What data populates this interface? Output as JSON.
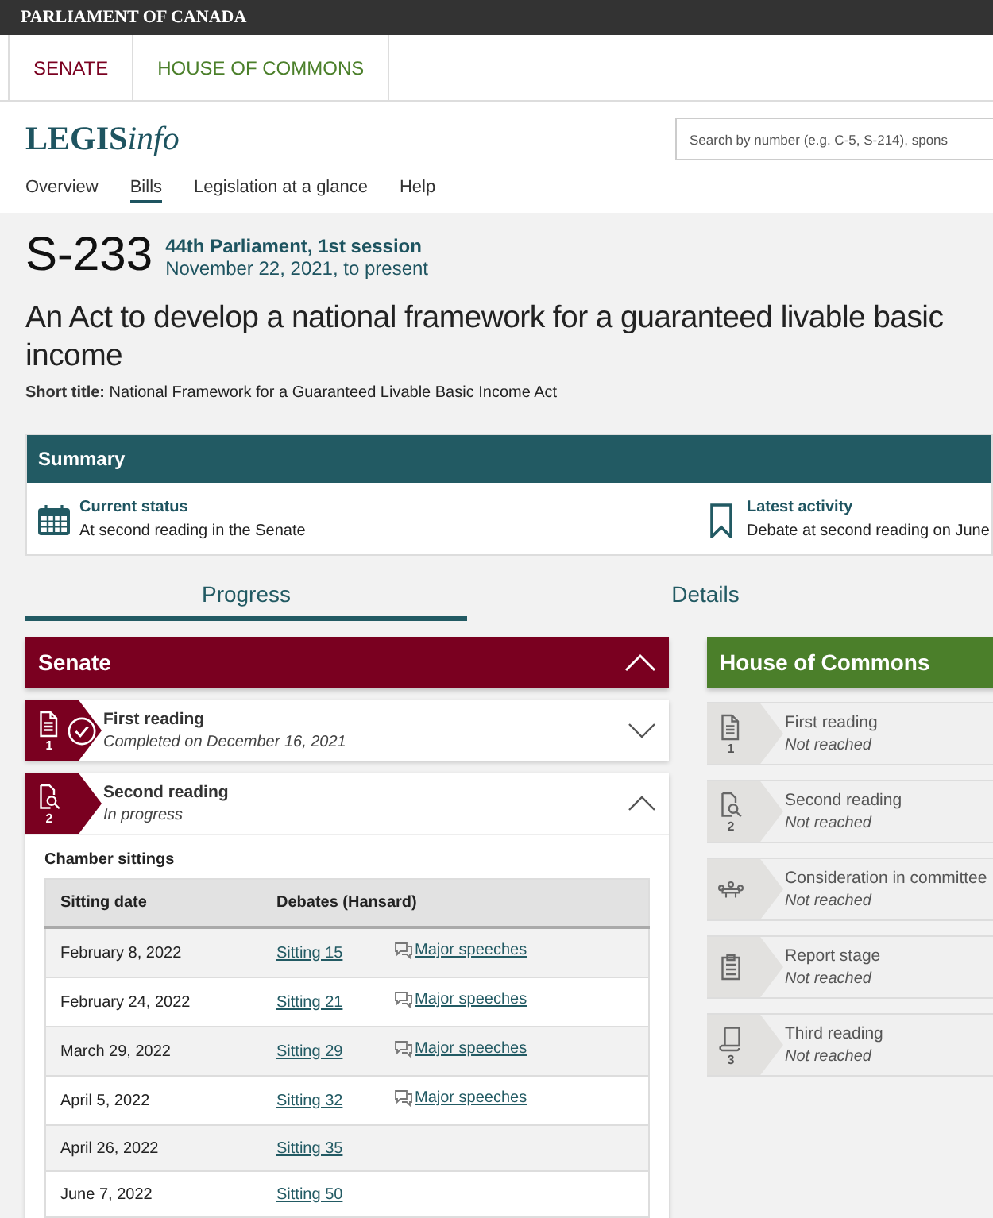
{
  "top_bar": {
    "title": "PARLIAMENT OF CANADA"
  },
  "chamber_tabs": [
    {
      "label": "SENATE",
      "color": "#7a0020"
    },
    {
      "label": "HOUSE OF COMMONS",
      "color": "#4b7f2a"
    }
  ],
  "logo": {
    "bold": "LEGIS",
    "italic": "info"
  },
  "search": {
    "placeholder": "Search by number (e.g. C-5, S-214), spons"
  },
  "nav": [
    {
      "label": "Overview",
      "selected": false
    },
    {
      "label": "Bills",
      "selected": true
    },
    {
      "label": "Legislation at a glance",
      "selected": false
    },
    {
      "label": "Help",
      "selected": false
    }
  ],
  "bill": {
    "number": "S-233",
    "session": "44th Parliament, 1st session",
    "dates": "November 22, 2021, to present",
    "title": "An Act to develop a national framework for a guaranteed livable basic income",
    "short_title_label": "Short title:",
    "short_title": "National Framework for a Guaranteed Livable Basic Income Act"
  },
  "summary": {
    "heading": "Summary",
    "items": [
      {
        "kind": "calendar",
        "label": "Current status",
        "value": "At second reading in the Senate"
      },
      {
        "kind": "bookmark",
        "label": "Latest activity",
        "value": "Debate at second reading on June"
      }
    ]
  },
  "view_tabs": [
    {
      "label": "Progress",
      "selected": true
    },
    {
      "label": "Details",
      "selected": false
    }
  ],
  "chambers": [
    {
      "name": "Senate",
      "color": "#7a0020",
      "expanded": true,
      "stages": [
        {
          "kind": "document",
          "number": "1",
          "name": "First reading",
          "status": "Completed on December 16, 2021",
          "reached": true,
          "completed": true,
          "expanded": false
        },
        {
          "kind": "magnifier",
          "number": "2",
          "name": "Second reading",
          "status": "In progress",
          "reached": true,
          "completed": false,
          "expanded": true,
          "sittings": {
            "heading": "Chamber sittings",
            "columns": [
              "Sitting date",
              "Debates (Hansard)"
            ],
            "rows": [
              {
                "date": "February 8, 2022",
                "sitting": "Sitting 15",
                "speeches": "Major speeches"
              },
              {
                "date": "February 24, 2022",
                "sitting": "Sitting 21",
                "speeches": "Major speeches"
              },
              {
                "date": "March 29, 2022",
                "sitting": "Sitting 29",
                "speeches": "Major speeches"
              },
              {
                "date": "April 5, 2022",
                "sitting": "Sitting 32",
                "speeches": "Major speeches"
              },
              {
                "date": "April 26, 2022",
                "sitting": "Sitting 35"
              },
              {
                "date": "June 7, 2022",
                "sitting": "Sitting 50"
              }
            ]
          }
        }
      ]
    },
    {
      "name": "House of Commons",
      "color": "#4b7f2a",
      "stages": [
        {
          "kind": "document",
          "number": "1",
          "name": "First reading",
          "status": "Not reached",
          "reached": false,
          "completed": false
        },
        {
          "kind": "magnifier",
          "number": "2",
          "name": "Second reading",
          "status": "Not reached",
          "reached": false,
          "completed": false
        },
        {
          "kind": "committee",
          "name": "Consideration in committee",
          "status": "Not reached",
          "reached": false,
          "completed": false
        },
        {
          "kind": "clipboard",
          "name": "Report stage",
          "status": "Not reached",
          "reached": false,
          "completed": false
        },
        {
          "kind": "scroll",
          "number": "3",
          "name": "Third reading",
          "status": "Not reached",
          "reached": false,
          "completed": false
        }
      ]
    }
  ]
}
